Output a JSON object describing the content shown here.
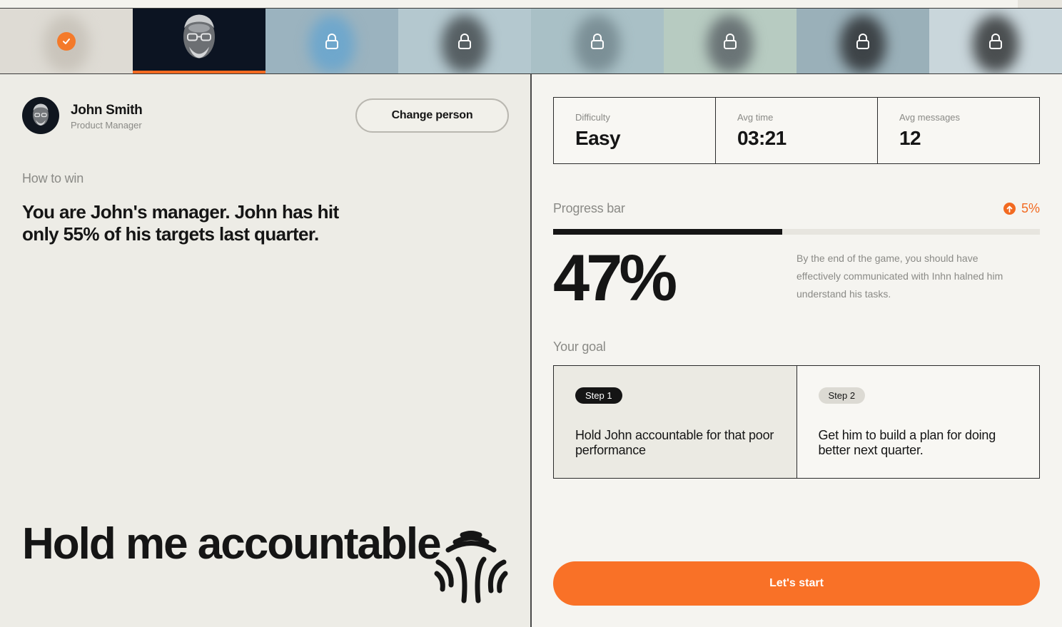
{
  "carousel": [
    {
      "state": "completed",
      "bg": "#dedbd4",
      "blob": "#c9c4bb"
    },
    {
      "state": "active",
      "bg": "#0c1422"
    },
    {
      "state": "locked",
      "bg": "#9bb3bf",
      "blob": "#6fa7cc"
    },
    {
      "state": "locked",
      "bg": "#b4c8cf",
      "blob": "#565f63"
    },
    {
      "state": "locked",
      "bg": "#a9c0c6",
      "blob": "#7b8f96"
    },
    {
      "state": "locked",
      "bg": "#b7cbc1",
      "blob": "#6a7476"
    },
    {
      "state": "locked",
      "bg": "#9ab0b9",
      "blob": "#3d4347"
    },
    {
      "state": "locked",
      "bg": "#c9d6db",
      "blob": "#4a4e50"
    }
  ],
  "person": {
    "name": "John Smith",
    "role": "Product Manager",
    "change_label": "Change person"
  },
  "how_to_win": {
    "label": "How to win",
    "text": "You are John's manager. John has hit only 55% of his targets last quarter."
  },
  "game_title": "Hold me accountable",
  "stats": [
    {
      "label": "Difficulty",
      "value": "Easy"
    },
    {
      "label": "Avg time",
      "value": "03:21"
    },
    {
      "label": "Avg messages",
      "value": "12"
    }
  ],
  "progress": {
    "label": "Progress bar",
    "delta": "5%",
    "fraction": 0.47,
    "percent_text": "47%",
    "description": "By the end of the game, you should have effectively communicated with Inhn halned him understand his tasks."
  },
  "goal": {
    "label": "Your goal",
    "steps": [
      {
        "badge": "Step 1",
        "text": "Hold John accountable for that poor performance",
        "current": true
      },
      {
        "badge": "Step 2",
        "text": "Get him to build a plan for doing better next quarter.",
        "current": false
      }
    ]
  },
  "start_label": "Let's start",
  "colors": {
    "accent": "#f97127",
    "dark": "#151515"
  }
}
